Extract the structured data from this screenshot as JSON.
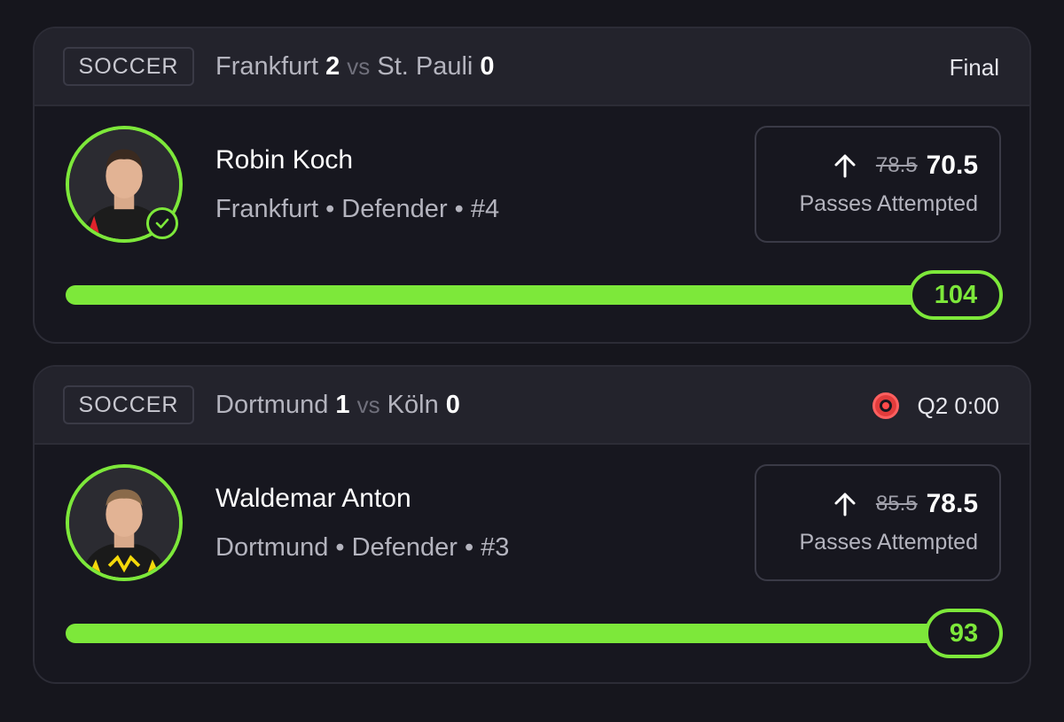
{
  "cards": [
    {
      "sport": "SOCCER",
      "home_team": "Frankfurt",
      "home_score": "2",
      "vs": "vs",
      "away_team": "St. Pauli",
      "away_score": "0",
      "status": "Final",
      "player": {
        "name": "Robin Koch",
        "meta": "Frankfurt • Defender • #4",
        "avatar_icon": "player-headshot",
        "check_icon": "check-icon",
        "jersey_color": "#1c1c1c",
        "jersey_accent": "#e0232b"
      },
      "projection": {
        "direction_icon": "arrow-up-icon",
        "old_line": "78.5",
        "new_line": "70.5",
        "stat": "Passes Attempted"
      },
      "result": {
        "value": "104",
        "progress_fraction": 1.0
      }
    },
    {
      "sport": "SOCCER",
      "home_team": "Dortmund",
      "home_score": "1",
      "vs": "vs",
      "away_team": "Köln",
      "away_score": "0",
      "status": "Q2 0:00",
      "status_icon": "live-indicator-icon",
      "player": {
        "name": "Waldemar Anton",
        "meta": "Dortmund • Defender • #3",
        "avatar_icon": "player-headshot",
        "jersey_color": "#1a1a1a",
        "jersey_accent": "#f5d90a"
      },
      "projection": {
        "direction_icon": "arrow-up-icon",
        "old_line": "85.5",
        "new_line": "78.5",
        "stat": "Passes Attempted"
      },
      "result": {
        "value": "93",
        "progress_fraction": 1.0
      }
    }
  ],
  "colors": {
    "accent_green": "#7de83a",
    "live_red": "#e23c3c",
    "background": "#16161d",
    "header_bg": "#23232c"
  }
}
